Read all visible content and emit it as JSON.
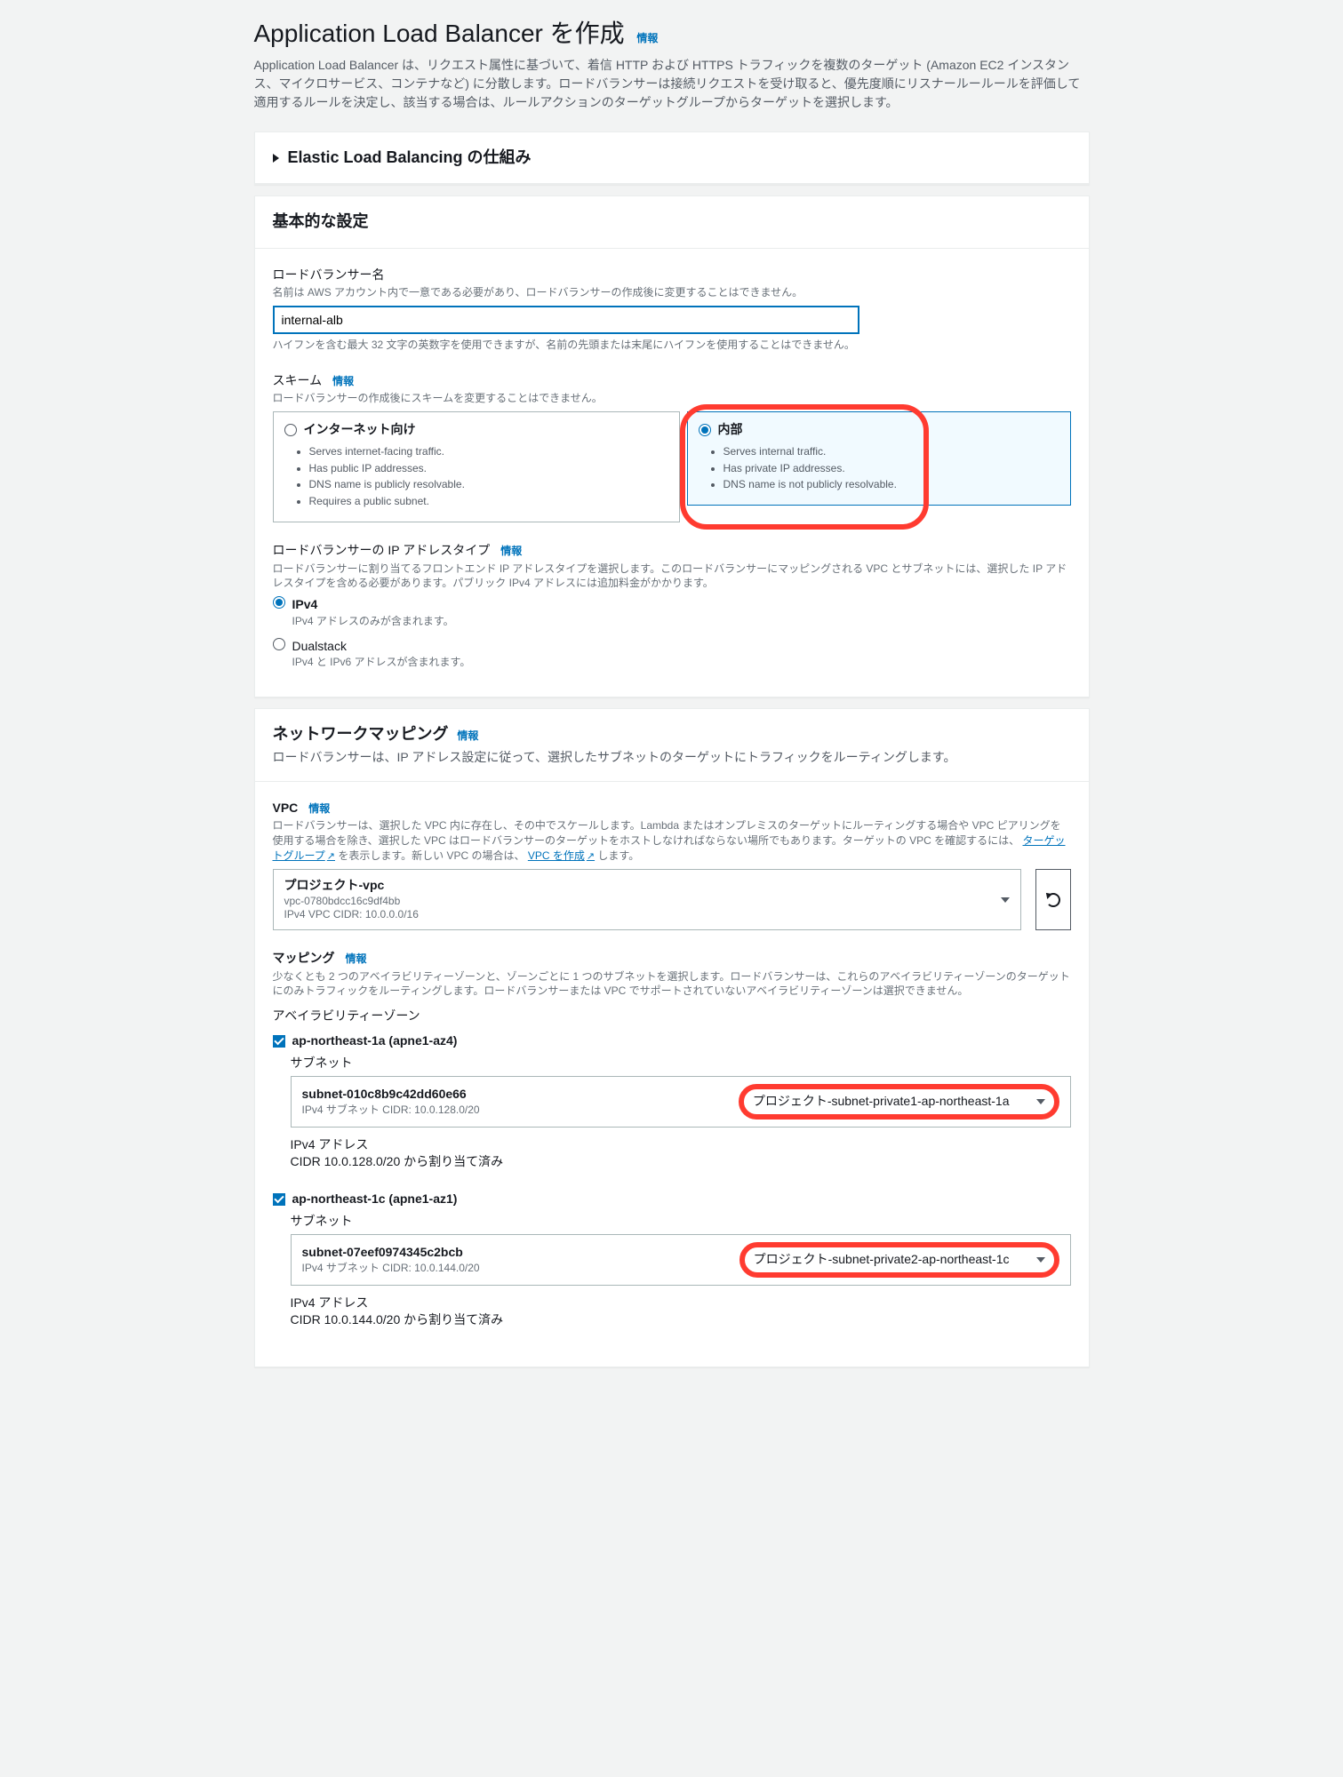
{
  "header": {
    "title": "Application Load Balancer を作成",
    "info": "情報",
    "description": "Application Load Balancer は、リクエスト属性に基づいて、着信 HTTP および HTTPS トラフィックを複数のターゲット (Amazon EC2 インスタンス、マイクロサービス、コンテナなど) に分散します。ロードバランサーは接続リクエストを受け取ると、優先度順にリスナールールールを評価して適用するルールを決定し、該当する場合は、ルールアクションのターゲットグループからターゲットを選択します。"
  },
  "collapse_panel": {
    "title": "Elastic Load Balancing の仕組み"
  },
  "basic": {
    "title": "基本的な設定",
    "name_label": "ロードバランサー名",
    "name_desc": "名前は AWS アカウント内で一意である必要があり、ロードバランサーの作成後に変更することはできません。",
    "name_value": "internal-alb",
    "name_hint": "ハイフンを含む最大 32 文字の英数字を使用できますが、名前の先頭または末尾にハイフンを使用することはできません。",
    "scheme_label": "スキーム",
    "scheme_desc": "ロードバランサーの作成後にスキームを変更することはできません。",
    "scheme_internet": {
      "title": "インターネット向け",
      "b1": "Serves internet-facing traffic.",
      "b2": "Has public IP addresses.",
      "b3": "DNS name is publicly resolvable.",
      "b4": "Requires a public subnet."
    },
    "scheme_internal": {
      "title": "内部",
      "b1": "Serves internal traffic.",
      "b2": "Has private IP addresses.",
      "b3": "DNS name is not publicly resolvable."
    },
    "iptype_label": "ロードバランサーの IP アドレスタイプ",
    "iptype_desc": "ロードバランサーに割り当てるフロントエンド IP アドレスタイプを選択します。このロードバランサーにマッピングされる VPC とサブネットには、選択した IP アドレスタイプを含める必要があります。パブリック IPv4 アドレスには追加料金がかかります。",
    "ip_v4": {
      "title": "IPv4",
      "desc": "IPv4 アドレスのみが含まれます。"
    },
    "ip_ds": {
      "title": "Dualstack",
      "desc": "IPv4 と IPv6 アドレスが含まれます。"
    }
  },
  "network": {
    "title": "ネットワークマッピング",
    "subtitle": "ロードバランサーは、IP アドレス設定に従って、選択したサブネットのターゲットにトラフィックをルーティングします。",
    "vpc_label": "VPC",
    "vpc_desc_pre": "ロードバランサーは、選択した VPC 内に存在し、その中でスケールします。Lambda またはオンプレミスのターゲットにルーティングする場合や VPC ピアリングを使用する場合を除き、選択した VPC はロードバランサーのターゲットをホストしなければならない場所でもあります。ターゲットの VPC を確認するには、",
    "vpc_link_tg": "ターゲットグループ",
    "vpc_desc_mid": "を表示します。新しい VPC の場合は、",
    "vpc_link_create": "VPC を作成",
    "vpc_desc_post": "します。",
    "vpc_selected": {
      "name": "プロジェクト-vpc",
      "id": "vpc-0780bdcc16c9df4bb",
      "cidr": "IPv4 VPC CIDR: 10.0.0.0/16"
    },
    "mapping_label": "マッピング",
    "mapping_desc": "少なくとも 2 つのアベイラビリティーゾーンと、ゾーンごとに 1 つのサブネットを選択します。ロードバランサーは、これらのアベイラビリティーゾーンのターゲットにのみトラフィックをルーティングします。ロードバランサーまたは VPC でサポートされていないアベイラビリティーゾーンは選択できません。",
    "az_title": "アベイラビリティーゾーン",
    "azs": [
      {
        "name": "ap-northeast-1a (apne1-az4)",
        "subnet_label": "サブネット",
        "subnet_id": "subnet-010c8b9c42dd60e66",
        "subnet_cidr": "IPv4 サブネット CIDR: 10.0.128.0/20",
        "subnet_name": "プロジェクト-subnet-private1-ap-northeast-1a",
        "ip_label": "IPv4 アドレス",
        "ip_value": "CIDR 10.0.128.0/20 から割り当て済み"
      },
      {
        "name": "ap-northeast-1c (apne1-az1)",
        "subnet_label": "サブネット",
        "subnet_id": "subnet-07eef0974345c2bcb",
        "subnet_cidr": "IPv4 サブネット CIDR: 10.0.144.0/20",
        "subnet_name": "プロジェクト-subnet-private2-ap-northeast-1c",
        "ip_label": "IPv4 アドレス",
        "ip_value": "CIDR 10.0.144.0/20 から割り当て済み"
      }
    ]
  },
  "info_label": "情報"
}
